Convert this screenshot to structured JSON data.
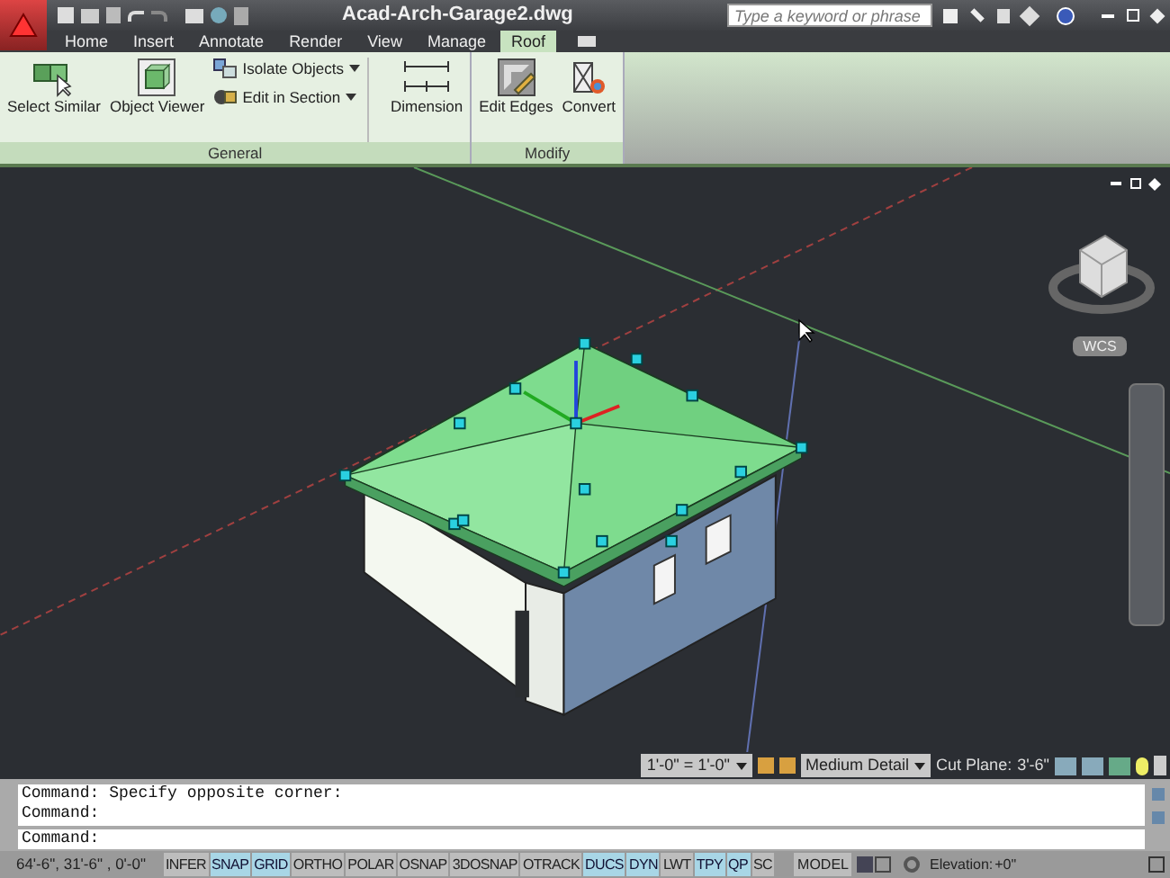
{
  "window": {
    "title": "Acad-Arch-Garage2.dwg"
  },
  "search": {
    "placeholder": "Type a keyword or phrase"
  },
  "tabs": [
    {
      "label": "Home",
      "selected": false
    },
    {
      "label": "Insert",
      "selected": false
    },
    {
      "label": "Annotate",
      "selected": false
    },
    {
      "label": "Render",
      "selected": false
    },
    {
      "label": "View",
      "selected": false
    },
    {
      "label": "Manage",
      "selected": false
    },
    {
      "label": "Roof",
      "selected": true
    }
  ],
  "ribbon": {
    "panels": [
      {
        "title": "General",
        "tools": [
          {
            "kind": "large",
            "label": "Select Similar"
          },
          {
            "kind": "large",
            "label": "Object Viewer"
          },
          {
            "kind": "small",
            "label": "Isolate Objects"
          },
          {
            "kind": "small",
            "label": "Edit in Section"
          },
          {
            "kind": "large",
            "label": "Dimension"
          }
        ]
      },
      {
        "title": "Modify",
        "tools": [
          {
            "kind": "large",
            "label": "Edit Edges"
          },
          {
            "kind": "large",
            "label": "Convert"
          }
        ]
      }
    ]
  },
  "viewport": {
    "ucs_label": "WCS"
  },
  "annotation_bar": {
    "scale": "1'-0\" = 1'-0\"",
    "detail": "Medium Detail",
    "cut_plane_label": "Cut Plane:",
    "cut_plane_value": "3'-6\""
  },
  "command_history": [
    "Command: Specify opposite corner:",
    "Command:"
  ],
  "command_prompt": "Command:",
  "status_bar": {
    "coordinates": "64'-6\", 31'-6\" , 0'-0\"",
    "toggles": [
      {
        "label": "INFER",
        "on": false
      },
      {
        "label": "SNAP",
        "on": true
      },
      {
        "label": "GRID",
        "on": true
      },
      {
        "label": "ORTHO",
        "on": false
      },
      {
        "label": "POLAR",
        "on": false
      },
      {
        "label": "OSNAP",
        "on": false
      },
      {
        "label": "3DOSNAP",
        "on": false
      },
      {
        "label": "OTRACK",
        "on": false
      },
      {
        "label": "DUCS",
        "on": true
      },
      {
        "label": "DYN",
        "on": true
      },
      {
        "label": "LWT",
        "on": false
      },
      {
        "label": "TPY",
        "on": true
      },
      {
        "label": "QP",
        "on": true
      },
      {
        "label": "SC",
        "on": false
      }
    ],
    "space": "MODEL",
    "elevation_label": "Elevation:",
    "elevation_value": "+0\""
  }
}
